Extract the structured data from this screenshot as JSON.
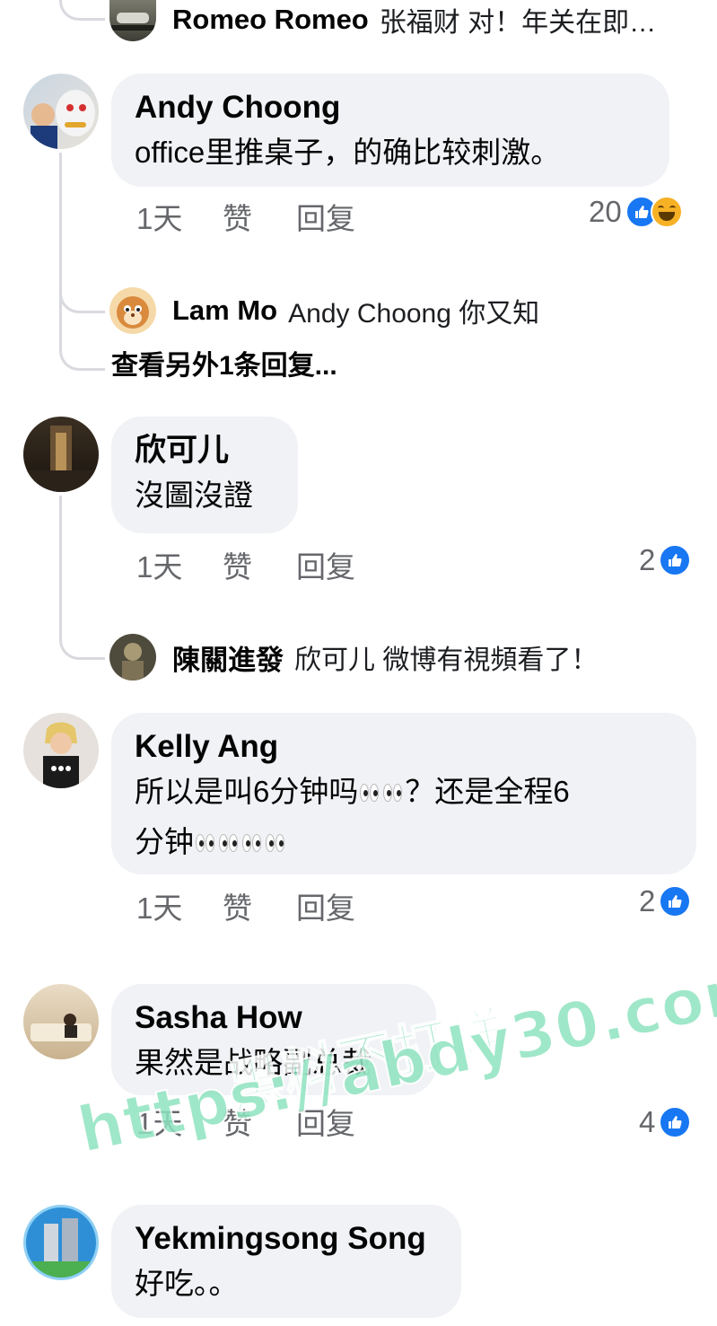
{
  "top_reply": {
    "name": "Romeo Romeo",
    "text": "张福财 对！年关在即…"
  },
  "comments": [
    {
      "name": "Andy Choong",
      "text_lines": [
        "office里推桌子，的确比较刺激。"
      ],
      "time": "1天",
      "like_label": "赞",
      "reply_label": "回复",
      "reaction_count": "20",
      "reactions": [
        "like-icon",
        "haha-icon"
      ],
      "reply": {
        "name": "Lam Mo",
        "text": "Andy Choong 你又知"
      },
      "view_more": "查看另外1条回复..."
    },
    {
      "name": "欣可儿",
      "text_lines": [
        "沒圖沒證"
      ],
      "time": "1天",
      "like_label": "赞",
      "reply_label": "回复",
      "reaction_count": "2",
      "reactions": [
        "like-icon"
      ],
      "reply": {
        "name": "陳關進發",
        "text": "欣可儿 微博有視頻看了！"
      }
    },
    {
      "name": "Kelly Ang",
      "text_lines": [
        "所以是叫6分钟吗",
        "？还是全程6",
        "分钟"
      ],
      "time": "1天",
      "like_label": "赞",
      "reply_label": "回复",
      "reaction_count": "2",
      "reactions": [
        "like-icon"
      ]
    },
    {
      "name": "Sasha How",
      "text_lines": [
        "果然是战略副总裁"
      ],
      "time": "1天",
      "like_label": "赞",
      "reply_label": "回复",
      "reaction_count": "4",
      "reactions": [
        "like-icon"
      ]
    },
    {
      "name": "Yekmingsong Song",
      "text_lines": [
        "好吃。。"
      ]
    }
  ],
  "watermark": {
    "line1": "黑料不打烊",
    "line2": "https://abdy30.com"
  },
  "colors": {
    "bubble": "#f0f2f5",
    "like_blue": "#1877f2",
    "meta_gray": "#65676b",
    "watermark": "#8fe3c0"
  }
}
